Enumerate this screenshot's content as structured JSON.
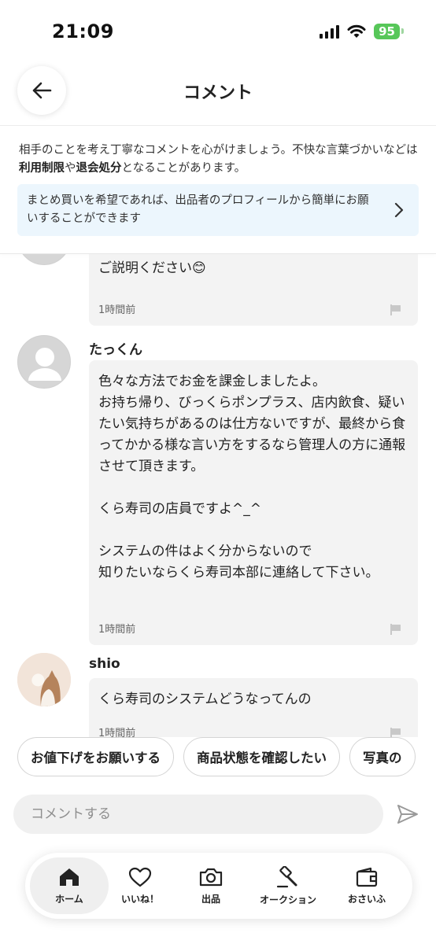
{
  "status_bar": {
    "time": "21:09",
    "battery": "95"
  },
  "header": {
    "title": "コメント"
  },
  "notice": {
    "text_before": "相手のことを考え丁寧なコメントを心がけましょう。不快な言葉づかいなどは",
    "strong1": "利用制限",
    "text_mid": "や",
    "strong2": "退会処分",
    "text_after": "となることがあります。"
  },
  "info_box": {
    "text": "まとめ買いを希望であれば、出品者のプロフィールから簡単にお願いすることができます"
  },
  "comments": [
    {
      "user": "",
      "text": "くら寿司公式の声明、見ましたか?\nご説明ください😊",
      "time": "1時間前"
    },
    {
      "user": "たっくん",
      "text": "色々な方法でお金を課金しましたよ。\nお持ち帰り、びっくらポンプラス、店内飲食、疑いたい気持ちがあるのは仕方ないですが、最終から食ってかかる様な言い方をするなら管理人の方に通報させて頂きます。\n\nくら寿司の店員ですよ^_^\n\nシステムの件はよく分からないので\n知りたいならくら寿司本部に連絡して下さい。",
      "time": "1時間前"
    },
    {
      "user": "shio",
      "text": "くら寿司のシステムどうなってんの",
      "time": "1時間前"
    }
  ],
  "chips": [
    "お値下げをお願いする",
    "商品状態を確認したい",
    "写真の"
  ],
  "comment_input": {
    "placeholder": "コメントする"
  },
  "nav": [
    {
      "label": "ホーム",
      "icon": "home-icon",
      "active": true
    },
    {
      "label": "いいね！",
      "icon": "heart-icon",
      "active": false
    },
    {
      "label": "出品",
      "icon": "camera-icon",
      "active": false
    },
    {
      "label": "オークション",
      "icon": "gavel-icon",
      "active": false
    },
    {
      "label": "おさいふ",
      "icon": "wallet-icon",
      "active": false
    }
  ]
}
